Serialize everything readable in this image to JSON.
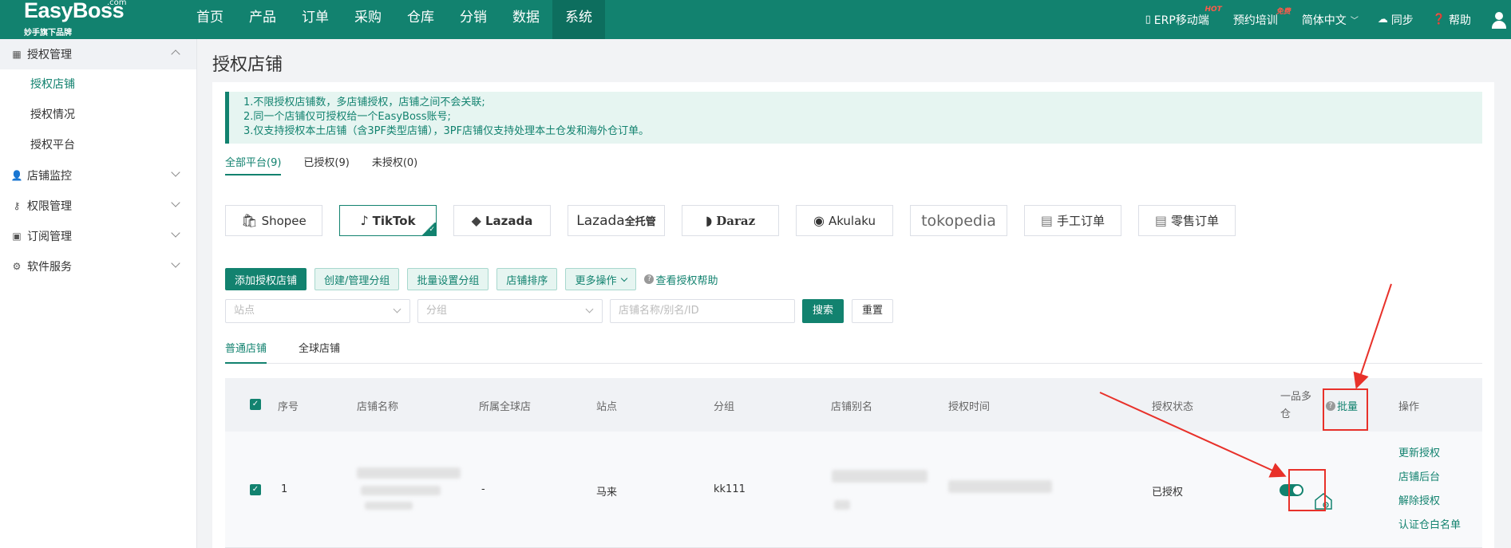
{
  "logo": {
    "brand": "EasyBoss",
    "com": ".com",
    "sub": "妙手旗下品牌"
  },
  "nav": [
    "首页",
    "产品",
    "订单",
    "采购",
    "仓库",
    "分销",
    "数据",
    "系统"
  ],
  "top_right": {
    "erp_mobile": "ERP移动端",
    "erp_badge": "HOT",
    "training": "预约培训",
    "training_badge": "免费",
    "language": "简体中文",
    "sync": "同步",
    "help": "帮助"
  },
  "sidebar": {
    "groups": [
      {
        "label": "授权管理",
        "expanded": true,
        "items": [
          "授权店铺",
          "授权情况",
          "授权平台"
        ]
      },
      {
        "label": "店铺监控"
      },
      {
        "label": "权限管理"
      },
      {
        "label": "订阅管理"
      },
      {
        "label": "软件服务"
      }
    ]
  },
  "page_title": "授权店铺",
  "notice": [
    "1.不限授权店铺数，多店铺授权，店铺之间不会关联;",
    "2.同一个店铺仅可授权给一个EasyBoss账号;",
    "3.仅支持授权本土店铺（含3PF类型店铺），3PF店铺仅支持处理本土仓发和海外仓订单。"
  ],
  "platform_tabs": [
    "全部平台(9)",
    "已授权(9)",
    "未授权(0)"
  ],
  "platforms": [
    "Shopee",
    "TikTok",
    "Lazada",
    "Lazada",
    "全托管",
    "Daraz",
    "Akulaku",
    "tokopedia",
    "手工订单",
    "零售订单"
  ],
  "toolbar": {
    "add": "添加授权店铺",
    "create_group": "创建/管理分组",
    "batch_group": "批量设置分组",
    "sort": "店铺排序",
    "more": "更多操作",
    "help": "查看授权帮助"
  },
  "filters": {
    "site_placeholder": "站点",
    "group_placeholder": "分组",
    "name_placeholder": "店铺名称/别名/ID",
    "search": "搜索",
    "reset": "重置"
  },
  "store_tabs": [
    "普通店铺",
    "全球店铺"
  ],
  "table": {
    "headers": {
      "index": "序号",
      "name": "店铺名称",
      "global": "所属全球店",
      "site": "站点",
      "group": "分组",
      "alias": "店铺别名",
      "time": "授权时间",
      "status": "授权状态",
      "multi_wh_1": "一品多",
      "multi_wh_2": "仓",
      "batch": "批量",
      "ops": "操作"
    },
    "row": {
      "index": "1",
      "global": "-",
      "site": "马来",
      "group": "kk111",
      "status": "已授权",
      "ops": [
        "更新授权",
        "店铺后台",
        "解除授权",
        "认证仓白名单"
      ]
    }
  },
  "colors": {
    "brand": "#12826f",
    "highlight": "#e8312a"
  }
}
